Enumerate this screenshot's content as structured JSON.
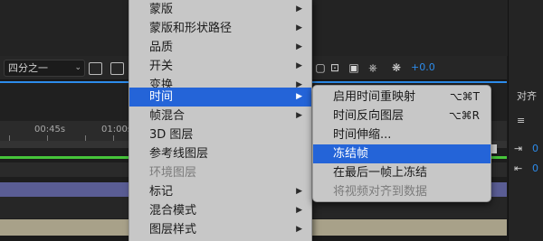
{
  "toolbar": {
    "zoom_value": "四分之一",
    "offset_value": "+0.0"
  },
  "timeline": {
    "ruler_labels": [
      "00:45s",
      "01:00s"
    ]
  },
  "right_panel": {
    "title": "对齐",
    "value_1": "0",
    "value_2": "0"
  },
  "menu": {
    "items": [
      {
        "label": "蒙版",
        "submenu": true,
        "enabled": true
      },
      {
        "label": "蒙版和形状路径",
        "submenu": true,
        "enabled": true
      },
      {
        "label": "品质",
        "submenu": true,
        "enabled": true
      },
      {
        "label": "开关",
        "submenu": true,
        "enabled": true
      },
      {
        "label": "变换",
        "submenu": true,
        "enabled": true
      },
      {
        "label": "时间",
        "submenu": true,
        "enabled": true,
        "selected": true
      },
      {
        "label": "帧混合",
        "submenu": true,
        "enabled": true
      },
      {
        "label": "3D 图层",
        "submenu": false,
        "enabled": true
      },
      {
        "label": "参考线图层",
        "submenu": false,
        "enabled": true
      },
      {
        "label": "环境图层",
        "submenu": false,
        "enabled": false
      },
      {
        "label": "标记",
        "submenu": true,
        "enabled": true
      },
      {
        "label": "混合模式",
        "submenu": true,
        "enabled": true
      },
      {
        "label": "图层样式",
        "submenu": true,
        "enabled": true
      }
    ]
  },
  "submenu": {
    "items": [
      {
        "label": "启用时间重映射",
        "shortcut": "⌥⌘T",
        "enabled": true
      },
      {
        "label": "时间反向图层",
        "shortcut": "⌥⌘R",
        "enabled": true
      },
      {
        "label": "时间伸缩...",
        "shortcut": "",
        "enabled": true
      },
      {
        "label": "冻结帧",
        "shortcut": "",
        "enabled": true,
        "selected": true
      },
      {
        "label": "在最后一帧上冻结",
        "shortcut": "",
        "enabled": true
      },
      {
        "label": "将视频对齐到数据",
        "shortcut": "",
        "enabled": false
      }
    ]
  },
  "colors": {
    "accent": "#2464d8",
    "offset_blue": "#2d8ceb",
    "timeline_green": "#46c43a"
  }
}
